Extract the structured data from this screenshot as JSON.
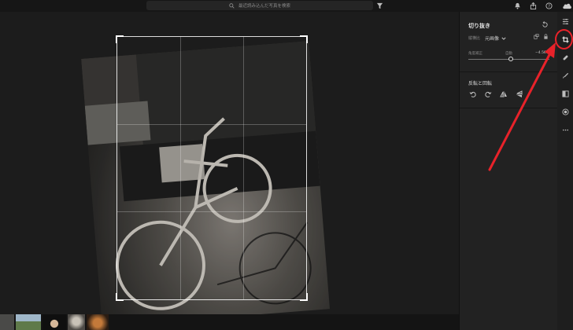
{
  "search": {
    "placeholder": "最近読み込んだ写真を検索"
  },
  "panel": {
    "title": "切り抜き",
    "aspect_label": "縦横比",
    "aspect_value": "元画像",
    "angle_label": "角度補正",
    "auto_label": "自動",
    "angle_value": "−4.56",
    "angle_slider_fraction": 0.52,
    "rotate_section_title": "反転と回転"
  },
  "colors": {
    "highlight": "#e8222a",
    "panel_bg": "#222222"
  },
  "icons": {
    "top": [
      "search-icon",
      "filter-icon",
      "bell-icon",
      "share-icon",
      "help-icon",
      "cloud-icon"
    ],
    "tools": [
      "sliders-icon",
      "crop-icon",
      "heal-icon",
      "brush-icon",
      "gradient-icon",
      "radial-icon",
      "more-icon"
    ],
    "rotate": [
      "rotate-left-icon",
      "rotate-right-icon",
      "flip-horizontal-icon",
      "flip-vertical-icon"
    ]
  }
}
